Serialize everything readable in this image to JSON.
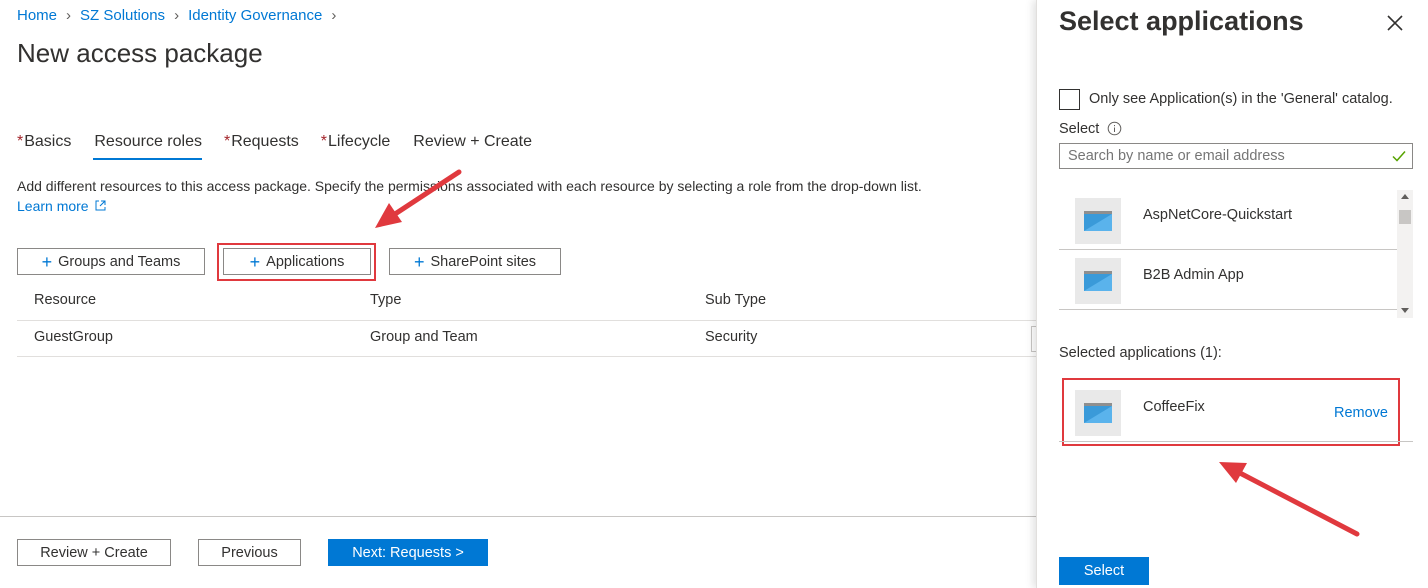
{
  "breadcrumb": [
    {
      "label": "Home"
    },
    {
      "label": "SZ Solutions"
    },
    {
      "label": "Identity Governance"
    }
  ],
  "page_title": "New access package",
  "tabs": [
    {
      "label": "Basics",
      "required": "*"
    },
    {
      "label": "Resource roles",
      "required": ""
    },
    {
      "label": "Requests",
      "required": "*"
    },
    {
      "label": "Lifecycle",
      "required": "*"
    },
    {
      "label": "Review + Create",
      "required": ""
    }
  ],
  "description": "Add different resources to this access package. Specify the permissions associated with each resource by selecting a role from the drop-down list.",
  "learn_more": "Learn more",
  "resource_buttons": {
    "groups": "Groups and Teams",
    "applications": "Applications",
    "sharepoint": "SharePoint sites"
  },
  "table": {
    "columns": [
      "Resource",
      "Type",
      "Sub Type"
    ],
    "rows": [
      {
        "resource": "GuestGroup",
        "type": "Group and Team",
        "subtype": "Security"
      }
    ]
  },
  "footer": {
    "review_create": "Review + Create",
    "previous": "Previous",
    "next": "Next: Requests >"
  },
  "panel": {
    "title": "Select applications",
    "checkbox_label": "Only see Application(s) in the 'General' catalog.",
    "select_label": "Select",
    "search_placeholder": "Search by name or email address",
    "apps": [
      {
        "name": "AspNetCore-Quickstart"
      },
      {
        "name": "B2B Admin App"
      }
    ],
    "selected_label": "Selected applications (1):",
    "selected_apps": [
      {
        "name": "CoffeeFix",
        "remove": "Remove"
      }
    ],
    "select_button": "Select"
  },
  "colors": {
    "accent": "#0078d4",
    "highlight": "#e0393e",
    "required": "#a4262c"
  },
  "icons": [
    "chevron-right-icon",
    "plus-icon",
    "external-link-icon",
    "close-icon",
    "info-icon",
    "checkmark-icon",
    "app-icon",
    "annotation-arrow"
  ]
}
